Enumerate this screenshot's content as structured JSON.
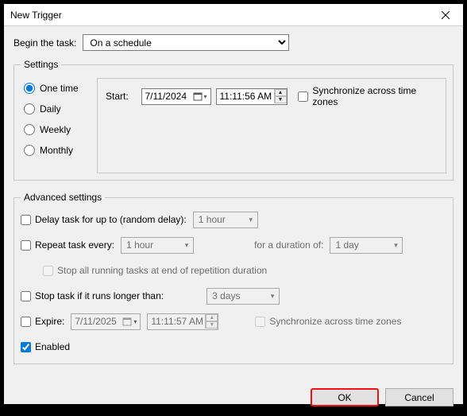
{
  "window": {
    "title": "New Trigger"
  },
  "begin": {
    "label": "Begin the task:",
    "selected": "On a schedule"
  },
  "settings": {
    "legend": "Settings",
    "freq": {
      "one": "One time",
      "daily": "Daily",
      "weekly": "Weekly",
      "monthly": "Monthly",
      "selected": "one"
    },
    "start_label": "Start:",
    "date": "7/11/2024",
    "time": "11:11:56 AM",
    "sync_label": "Synchronize across time zones"
  },
  "advanced": {
    "legend": "Advanced settings",
    "delay_label": "Delay task for up to (random delay):",
    "delay_value": "1 hour",
    "repeat_label": "Repeat task every:",
    "repeat_value": "1 hour",
    "duration_label": "for a duration of:",
    "duration_value": "1 day",
    "stop_running_label": "Stop all running tasks at end of repetition duration",
    "stop_longer_label": "Stop task if it runs longer than:",
    "stop_longer_value": "3 days",
    "expire_label": "Expire:",
    "expire_date": "7/11/2025",
    "expire_time": "11:11:57 AM",
    "sync2_label": "Synchronize across time zones",
    "enabled_label": "Enabled"
  },
  "buttons": {
    "ok": "OK",
    "cancel": "Cancel"
  }
}
